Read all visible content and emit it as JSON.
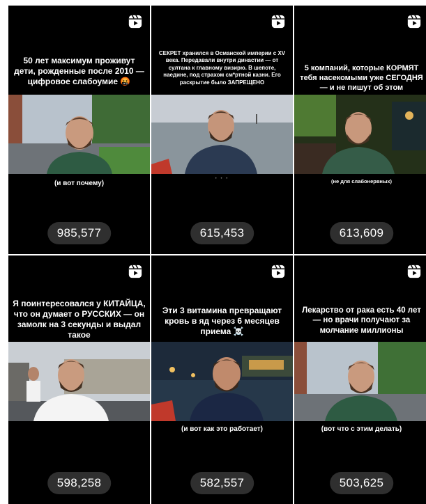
{
  "reels": [
    {
      "caption": "50 лет максимум проживут дети, рожденные после 2010 — цифровое слабоумие 🤬",
      "subtext": "(и вот почему)",
      "views": "985,577",
      "icon": "reel-icon"
    },
    {
      "caption": "СЕКРЕТ хранился в Османской империи с XV века. Передавали внутри династии — от султана к главному визирю. В шепоте, наедине, под страхом см*ртной казни. Его раскрытие было ЗАПРЕЩЕНО",
      "subtext": "",
      "dots": "• • •",
      "views": "615,453",
      "icon": "reel-icon"
    },
    {
      "caption": "5 компаний, которые КОРМЯТ тебя насекомыми уже СЕГОДНЯ — и не пишут об этом",
      "subtext": "(не для слабонервных)",
      "views": "613,609",
      "icon": "reel-icon"
    },
    {
      "caption": "Я поинтересовался у КИТАЙЦА, что он думает о РУССКИХ — он замолк на 3 секунды и выдал такое",
      "subtext": "",
      "views": "598,258",
      "icon": "reel-icon"
    },
    {
      "caption": "Эти 3 витамина превращают кровь в яд через 6 месяцев приема ☠️",
      "subtext": "(и вот как это работает)",
      "views": "582,557",
      "icon": "reel-icon"
    },
    {
      "caption": "Лекарство от рака есть 40 лет — но врачи получают за молчание миллионы",
      "subtext": "(вот что с этим делать)",
      "views": "503,625",
      "icon": "reel-icon"
    }
  ]
}
